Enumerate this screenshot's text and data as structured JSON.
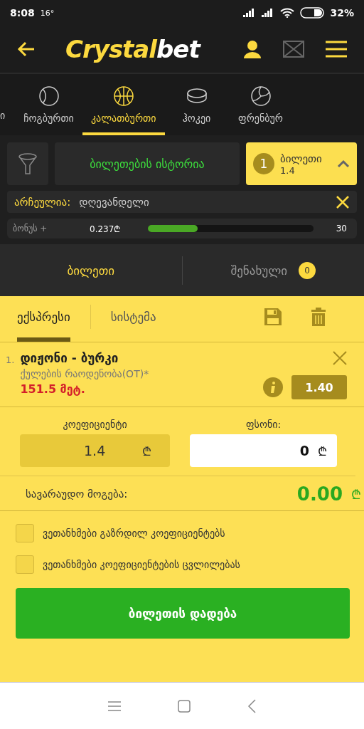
{
  "status_bar": {
    "time": "8:08",
    "temperature": "16°",
    "battery": "32%"
  },
  "header": {
    "logo_part_1": "Crystal",
    "logo_part_2": "bet"
  },
  "sport_tabs": [
    {
      "label": "ი",
      "selected": false,
      "kind": "none"
    },
    {
      "label": "ჩოგბურთი",
      "selected": false,
      "kind": "tennis"
    },
    {
      "label": "კალათბურთი",
      "selected": true,
      "kind": "basketball"
    },
    {
      "label": "ჰოკეი",
      "selected": false,
      "kind": "puck"
    },
    {
      "label": "ფრენბურ",
      "selected": false,
      "kind": "volleyball"
    }
  ],
  "toolbar": {
    "history_button": "ბილეთების ისტორია",
    "ticket_count": "1",
    "ticket_label": "ბილეთი",
    "ticket_odds": "1.4"
  },
  "filter": {
    "label": "არჩეულია:",
    "value": "დღევანდელი"
  },
  "bonus": {
    "label": "ბონუს +",
    "amount": "0.237₾",
    "level": 0.3,
    "target": "30"
  },
  "slip_tabs": [
    {
      "label": "ბილეთი",
      "selected": true
    },
    {
      "label": "შენახული",
      "selected": false,
      "count": "0"
    }
  ],
  "bet_types": [
    {
      "label": "ექსპრესი",
      "selected": true
    },
    {
      "label": "სისტემა",
      "selected": false
    }
  ],
  "selections": [
    {
      "number": "1.",
      "match": "დიჟონი - ბურკი",
      "market": "ქულების რაოდენობა(OT)*",
      "pick": "151.5 მეტ.",
      "odds": "1.40"
    }
  ],
  "odds_field": {
    "label": "კოეფიციენტი",
    "value": "1.4",
    "currency": "₾"
  },
  "stake_field": {
    "label": "ფსონი:",
    "value": "0",
    "currency": "₾"
  },
  "potential_win": {
    "label": "სავარაუდო მოგება:",
    "value": "0.00",
    "currency": "₾"
  },
  "options": [
    {
      "label": "ვეთანხმები გაზრდილ კოეფიციენტებს",
      "checked": false
    },
    {
      "label": "ვეთანხმები კოეფიციენტების ცვლილებას",
      "checked": false
    }
  ],
  "place_bet_button": "ბილეთის დადება"
}
